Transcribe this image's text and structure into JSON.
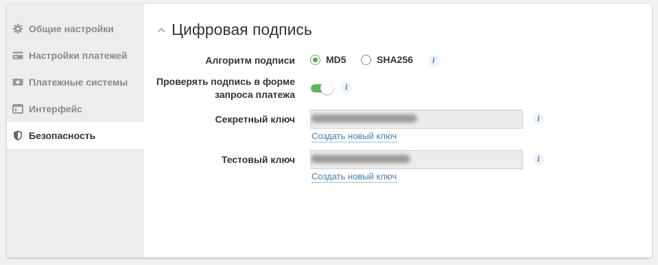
{
  "sidebar": {
    "items": [
      {
        "label": "Общие настройки",
        "icon": "gear-icon"
      },
      {
        "label": "Настройки платежей",
        "icon": "card-icon"
      },
      {
        "label": "Платежные системы",
        "icon": "money-icon"
      },
      {
        "label": "Интерфейс",
        "icon": "window-icon"
      },
      {
        "label": "Безопасность",
        "icon": "shield-icon",
        "active": true
      }
    ]
  },
  "section": {
    "title": "Цифровая подпись"
  },
  "form": {
    "algorithm": {
      "label": "Алгоритм подписи",
      "options": [
        "MD5",
        "SHA256"
      ],
      "selected": "MD5"
    },
    "verify": {
      "label_line1": "Проверять подпись в форме",
      "label_line2": "запроса платежа",
      "enabled": true
    },
    "secret_key": {
      "label": "Секретный ключ",
      "link": "Создать новый ключ"
    },
    "test_key": {
      "label": "Тестовый ключ",
      "link": "Создать новый ключ"
    },
    "info_glyph": "i"
  },
  "colors": {
    "accent_green": "#5cb85c",
    "link_blue": "#3f7fb8",
    "sidebar_bg": "#ededed"
  }
}
